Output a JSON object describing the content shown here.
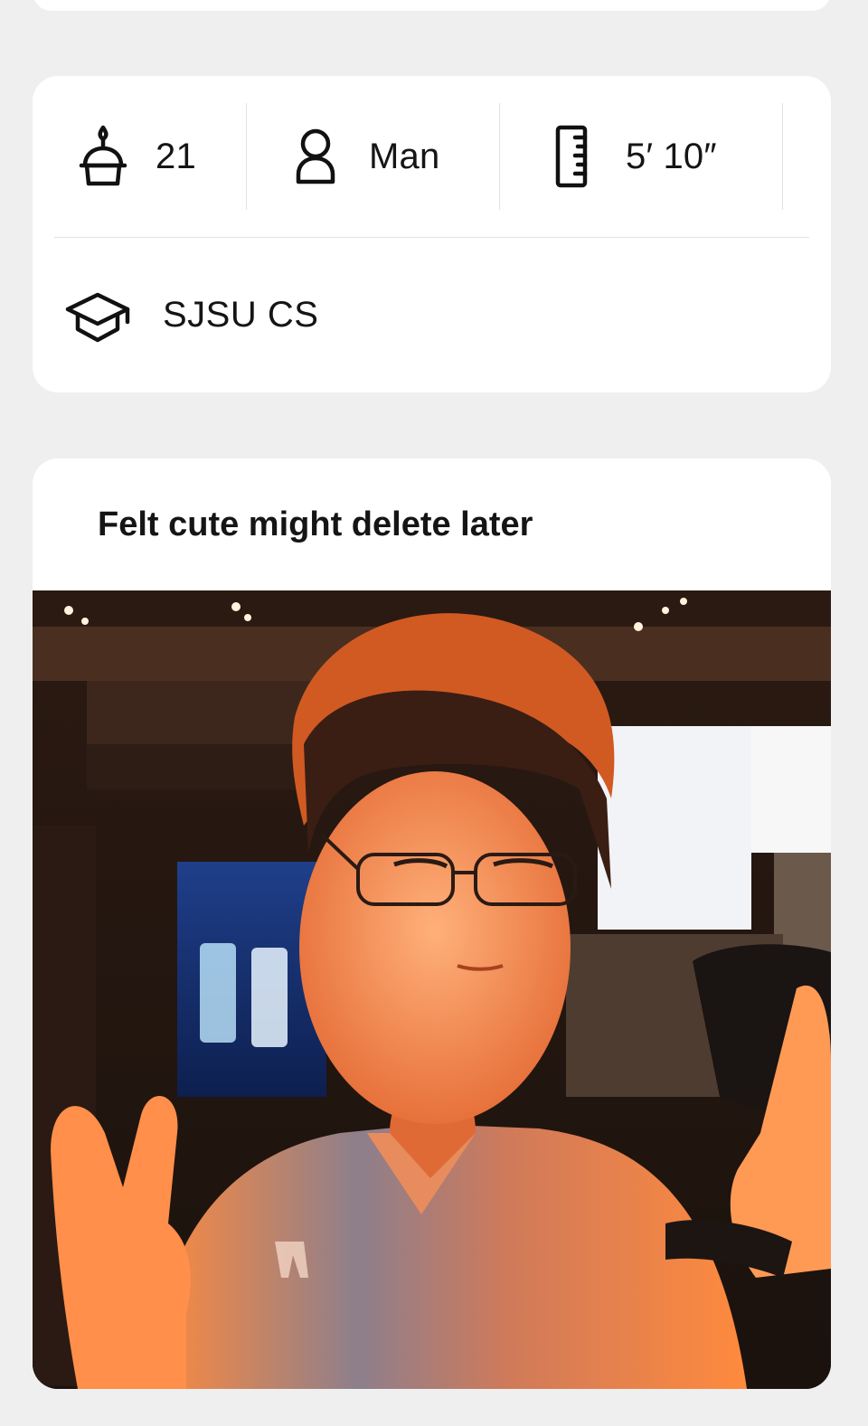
{
  "vitals": {
    "age": "21",
    "gender": "Man",
    "height": "5′ 10″",
    "education": "SJSU CS"
  },
  "prompt": {
    "caption": "Felt cute might delete later"
  },
  "icons": {
    "age": "birthday-cake-icon",
    "gender": "person-icon",
    "height": "ruler-icon",
    "education": "graduation-cap-icon"
  }
}
